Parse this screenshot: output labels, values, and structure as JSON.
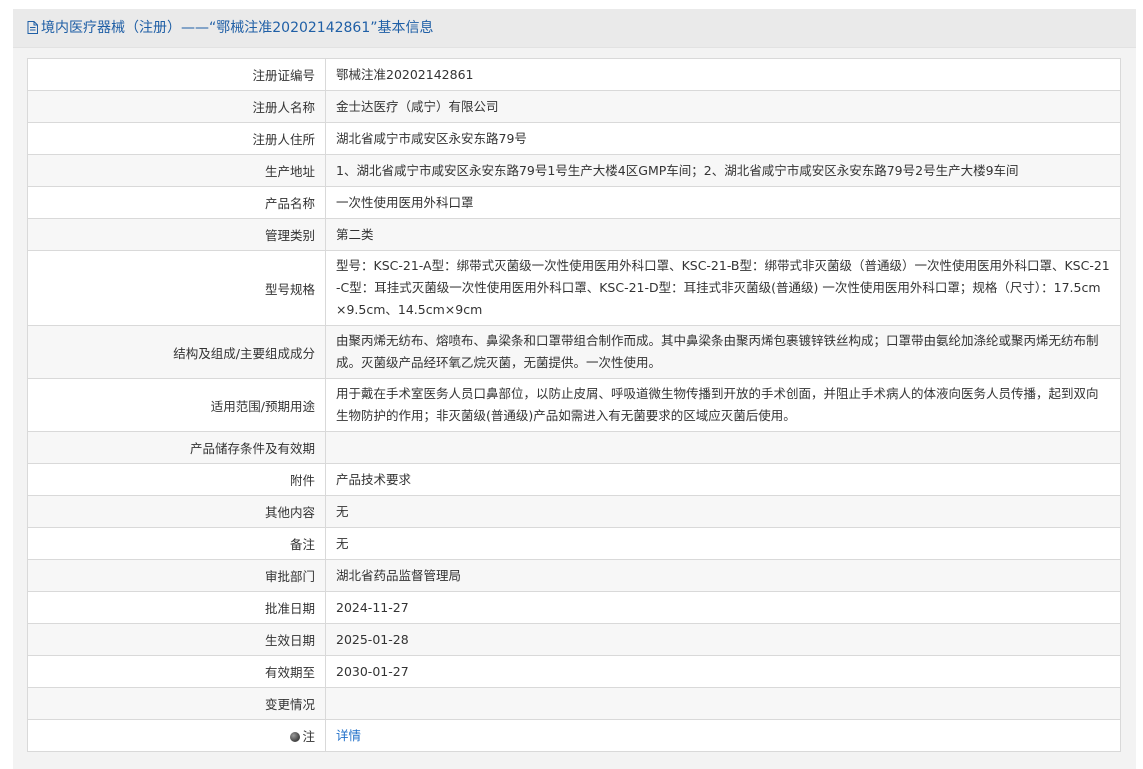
{
  "header": {
    "title": "境内医疗器械（注册）——“鄂械注准20202142861”基本信息",
    "icon": "document-icon"
  },
  "rows": [
    {
      "label": "注册证编号",
      "value": "鄂械注准20202142861"
    },
    {
      "label": "注册人名称",
      "value": "金士达医疗（咸宁）有限公司"
    },
    {
      "label": "注册人住所",
      "value": "湖北省咸宁市咸安区永安东路79号"
    },
    {
      "label": "生产地址",
      "value": "1、湖北省咸宁市咸安区永安东路79号1号生产大楼4区GMP车间；2、湖北省咸宁市咸安区永安东路79号2号生产大楼9车间"
    },
    {
      "label": "产品名称",
      "value": "一次性使用医用外科口罩"
    },
    {
      "label": "管理类别",
      "value": "第二类"
    },
    {
      "label": "型号规格",
      "value": "型号：KSC-21-A型：绑带式灭菌级一次性使用医用外科口罩、KSC-21-B型：绑带式非灭菌级（普通级）一次性使用医用外科口罩、KSC-21-C型：耳挂式灭菌级一次性使用医用外科口罩、KSC-21-D型：耳挂式非灭菌级(普通级) 一次性使用医用外科口罩；规格（尺寸）：17.5cm×9.5cm、14.5cm×9cm"
    },
    {
      "label": "结构及组成/主要组成成分",
      "value": "由聚丙烯无纺布、熔喷布、鼻梁条和口罩带组合制作而成。其中鼻梁条由聚丙烯包裹镀锌铁丝构成；口罩带由氨纶加涤纶或聚丙烯无纺布制成。灭菌级产品经环氧乙烷灭菌，无菌提供。一次性使用。"
    },
    {
      "label": "适用范围/预期用途",
      "value": "用于戴在手术室医务人员口鼻部位，以防止皮屑、呼吸道微生物传播到开放的手术创面，并阻止手术病人的体液向医务人员传播，起到双向生物防护的作用；非灭菌级(普通级)产品如需进入有无菌要求的区域应灭菌后使用。"
    },
    {
      "label": "产品储存条件及有效期",
      "value": ""
    },
    {
      "label": "附件",
      "value": "产品技术要求"
    },
    {
      "label": "其他内容",
      "value": "无"
    },
    {
      "label": "备注",
      "value": "无"
    },
    {
      "label": "审批部门",
      "value": "湖北省药品监督管理局"
    },
    {
      "label": "批准日期",
      "value": "2024-11-27"
    },
    {
      "label": "生效日期",
      "value": "2025-01-28"
    },
    {
      "label": "有效期至",
      "value": "2030-01-27"
    },
    {
      "label": "变更情况",
      "value": ""
    }
  ],
  "note": {
    "label": "注",
    "icon": "note-icon",
    "link_text": "详情"
  },
  "colors": {
    "title": "#1f5fa6",
    "link": "#1f6fc9",
    "border": "#d9d9d9"
  }
}
